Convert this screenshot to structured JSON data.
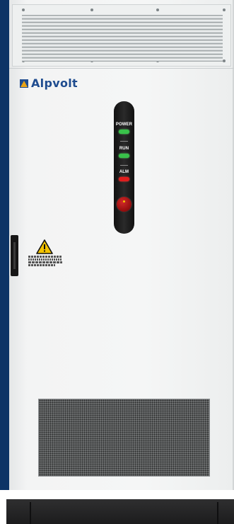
{
  "brand": {
    "name": "Alpvolt",
    "color": "#1f4c8f",
    "accent": "#e8a316"
  },
  "indicators": {
    "power_label": "POWER",
    "run_label": "RUN",
    "alarm_label": "ALM",
    "power_color": "#39c24a",
    "run_color": "#39c24a",
    "alarm_color": "#e01e1e"
  },
  "warning": {
    "icon": "warning-triangle-icon"
  },
  "colors": {
    "backdrop": "#0d3466",
    "cabinet": "#f3f4f4",
    "grille": "#6d6f70",
    "plinth": "#1c1c1d"
  }
}
